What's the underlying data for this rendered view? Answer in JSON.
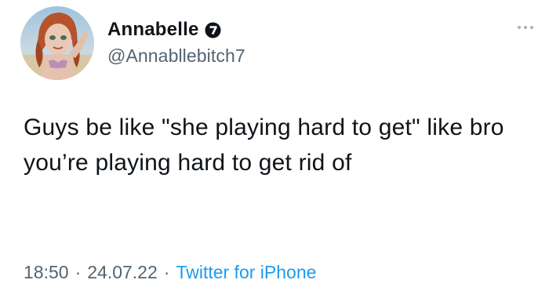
{
  "tweet": {
    "display_name": "Annabelle",
    "handle": "@Annabllebitch7",
    "text": "Guys be like \"she playing hard to get\" like bro you’re playing hard to get rid of",
    "time": "18:50",
    "date": "24.07.22",
    "separator": "·",
    "source": "Twitter for iPhone"
  },
  "icons": {
    "avatar": "avatar-doll-image",
    "badge": "badge-icon",
    "more": "more-options-icon"
  },
  "colors": {
    "text": "#0f1419",
    "secondary": "#536471",
    "link": "#1d9bf0"
  }
}
